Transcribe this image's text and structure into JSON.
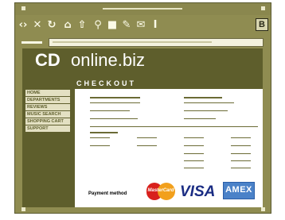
{
  "window": {
    "colors": {
      "frame": "#8f8c51",
      "content": "#5e5e2c",
      "panel": "#ffffff"
    }
  },
  "toolbar": {
    "icons": [
      "back-forward-arrows-icon",
      "stop-icon",
      "reload-icon",
      "home-icon",
      "upload-icon",
      "search-icon",
      "print-icon",
      "pin-icon",
      "mail-icon",
      "cursor-icon"
    ],
    "bookmark_label": "B"
  },
  "logo": {
    "brand": "CD",
    "domain": "online.biz"
  },
  "nav": {
    "items": [
      {
        "label": "HOME"
      },
      {
        "label": "DEPARTMENTS"
      },
      {
        "label": "REVIEWS"
      },
      {
        "label": "MUSIC SEARCH"
      },
      {
        "label": "SHOPPING CART"
      },
      {
        "label": "SUPPORT"
      }
    ]
  },
  "checkout": {
    "title": "CHECKOUT",
    "payment_label": "Payment method",
    "cards": {
      "mastercard": "MasterCard",
      "visa": "VISA",
      "amex": "AMEX"
    }
  }
}
